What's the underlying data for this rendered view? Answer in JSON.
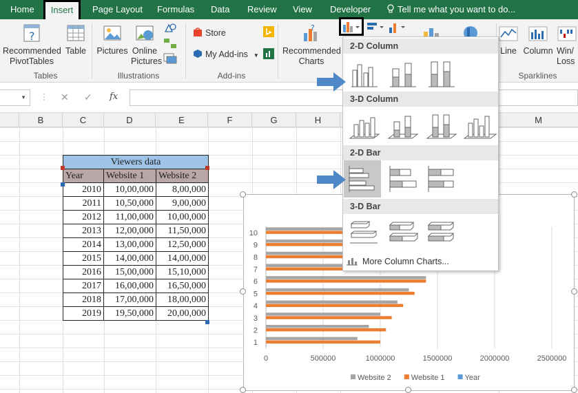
{
  "ribbon_tabs": [
    "Home",
    "Insert",
    "Page Layout",
    "Formulas",
    "Data",
    "Review",
    "View",
    "Developer"
  ],
  "tell_me": "Tell me what you want to do...",
  "ribbon": {
    "recommended_pivot": "Recommended PivotTables",
    "table": "Table",
    "tables_group": "Tables",
    "pictures": "Pictures",
    "online_pictures": "Online Pictures",
    "illustrations_group": "Illustrations",
    "store": "Store",
    "my_addins": "My Add-ins",
    "addins_group": "Add-ins",
    "recommended_charts": "Recommended Charts",
    "line": "Line",
    "column": "Column",
    "winloss": "Win/ Loss",
    "sparklines_group": "Sparklines"
  },
  "formula_bar": {
    "fx": "fx",
    "cancel": "✕",
    "confirm": "✓"
  },
  "columns": [
    "B",
    "C",
    "D",
    "E",
    "F",
    "G",
    "H",
    "M"
  ],
  "sheet_table": {
    "title": "Viewers data",
    "headers": [
      "Year",
      "Website 1",
      "Website 2"
    ],
    "rows": [
      [
        "2010",
        "10,00,000",
        "8,00,000"
      ],
      [
        "2011",
        "10,50,000",
        "9,00,000"
      ],
      [
        "2012",
        "11,00,000",
        "10,00,000"
      ],
      [
        "2013",
        "12,00,000",
        "11,50,000"
      ],
      [
        "2014",
        "13,00,000",
        "12,50,000"
      ],
      [
        "2015",
        "14,00,000",
        "14,00,000"
      ],
      [
        "2016",
        "15,00,000",
        "15,10,000"
      ],
      [
        "2017",
        "16,00,000",
        "16,50,000"
      ],
      [
        "2018",
        "17,00,000",
        "18,00,000"
      ],
      [
        "2019",
        "19,50,000",
        "20,00,000"
      ]
    ]
  },
  "dropdown": {
    "sections": [
      "2-D Column",
      "3-D Column",
      "2-D Bar",
      "3-D Bar"
    ],
    "more": "More Column Charts..."
  },
  "chart_data": {
    "type": "bar",
    "orientation": "horizontal",
    "categories": [
      "1",
      "2",
      "3",
      "4",
      "5",
      "6",
      "7",
      "8",
      "9",
      "10"
    ],
    "series": [
      {
        "name": "Year",
        "values": [
          2010,
          2011,
          2012,
          2013,
          2014,
          2015,
          2016,
          2017,
          2018,
          2019
        ],
        "color": "#5b9bd5"
      },
      {
        "name": "Website 1",
        "values": [
          1000000,
          1050000,
          1100000,
          1200000,
          1300000,
          1400000,
          1500000,
          1600000,
          1700000,
          1950000
        ],
        "color": "#ed7d31"
      },
      {
        "name": "Website 2",
        "values": [
          800000,
          900000,
          1000000,
          1150000,
          1250000,
          1400000,
          1510000,
          1650000,
          1800000,
          2000000
        ],
        "color": "#a5a5a5"
      }
    ],
    "xlim": [
      0,
      2500000
    ],
    "x_ticks": [
      "0",
      "500000",
      "1000000",
      "1500000",
      "2000000",
      "2500000"
    ],
    "legend": [
      "Website 2",
      "Website 1",
      "Year"
    ],
    "legend_position": "bottom",
    "grid": true
  },
  "colors": {
    "excel_green": "#217346",
    "table_title": "#9dc3e6",
    "table_header": "#b9a7a7",
    "arrow": "#4f88c6"
  }
}
